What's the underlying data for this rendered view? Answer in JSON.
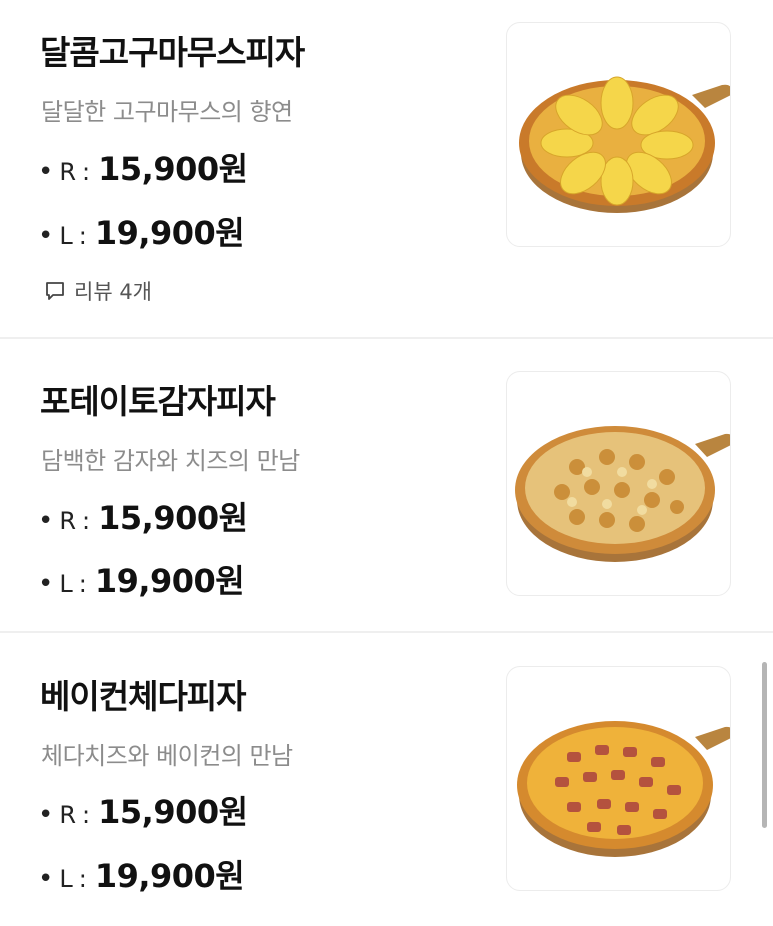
{
  "menu": {
    "items": [
      {
        "name": "달콤고구마무스피자",
        "description": "달달한 고구마무스의 향연",
        "prices": [
          {
            "size": "R",
            "amount": "15,900원"
          },
          {
            "size": "L",
            "amount": "19,900원"
          }
        ],
        "review_label": "리뷰 4개",
        "image_icon": "sweet-potato-pizza-image"
      },
      {
        "name": "포테이토감자피자",
        "description": "담백한 감자와 치즈의 만남",
        "prices": [
          {
            "size": "R",
            "amount": "15,900원"
          },
          {
            "size": "L",
            "amount": "19,900원"
          }
        ],
        "image_icon": "potato-pizza-image"
      },
      {
        "name": "베이컨체다피자",
        "description": "체다치즈와 베이컨의 만남",
        "prices": [
          {
            "size": "R",
            "amount": "15,900원"
          },
          {
            "size": "L",
            "amount": "19,900원"
          }
        ],
        "image_icon": "bacon-cheddar-pizza-image"
      }
    ],
    "price_bullet": "•",
    "price_separator": ":"
  },
  "colors": {
    "title": "#111111",
    "description": "#8c8c8c",
    "divider": "#efefef",
    "scrollbar": "#b5b5b5"
  }
}
